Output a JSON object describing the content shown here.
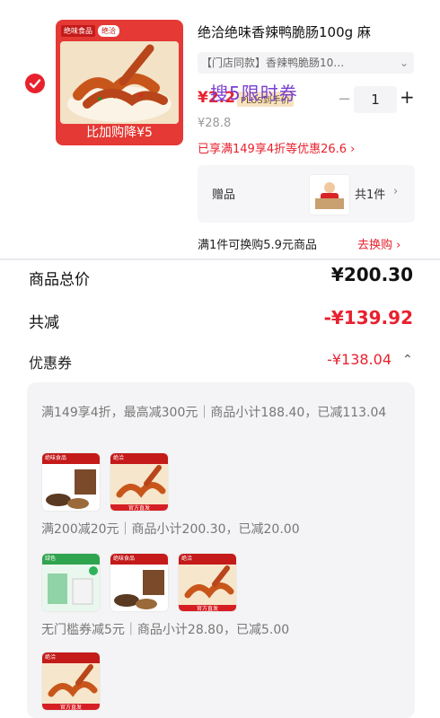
{
  "product": {
    "title": "绝洽绝味香辣鸭脆肠100g 麻",
    "sku_label": "【门店同款】香辣鸭脆肠10…",
    "price": "¥2.2",
    "plus_label": "PLUS到手价",
    "overlay_text": "搜5限时券",
    "quantity": "1",
    "minus_symbol": "−",
    "plus_symbol": "+",
    "original_price": "¥28.8",
    "promo_text": "已享满149享4折等优惠26.6 ›",
    "thumb_caption": "比加购降¥5",
    "brand_tag1": "绝味食品",
    "brand_tag2": "绝洽",
    "gift_label": "赠品",
    "gift_count": "共1件",
    "gift_chevron": "›",
    "swap_text": "满1件可换购5.9元商品",
    "swap_link": "去换购 ›"
  },
  "summary": {
    "total_label": "商品总价",
    "total_value": "¥200.30",
    "reduce_label": "共减",
    "reduce_value": "-¥139.92",
    "coupon_label": "优惠券",
    "coupon_value": "-¥138.04",
    "coupon_chevron": "⌃"
  },
  "coupon_details": [
    {
      "text": "满149享4折，最高减300元｜商品小计188.40，已减113.04"
    },
    {
      "text": "满200减20元｜商品小计200.30，已减20.00"
    },
    {
      "text": "无门槛券减5元｜商品小计28.80，已减5.00"
    }
  ],
  "colors": {
    "accent": "#e8212e",
    "panel_bg": "#f4f4f6",
    "overlay": "#7b3fd1"
  }
}
